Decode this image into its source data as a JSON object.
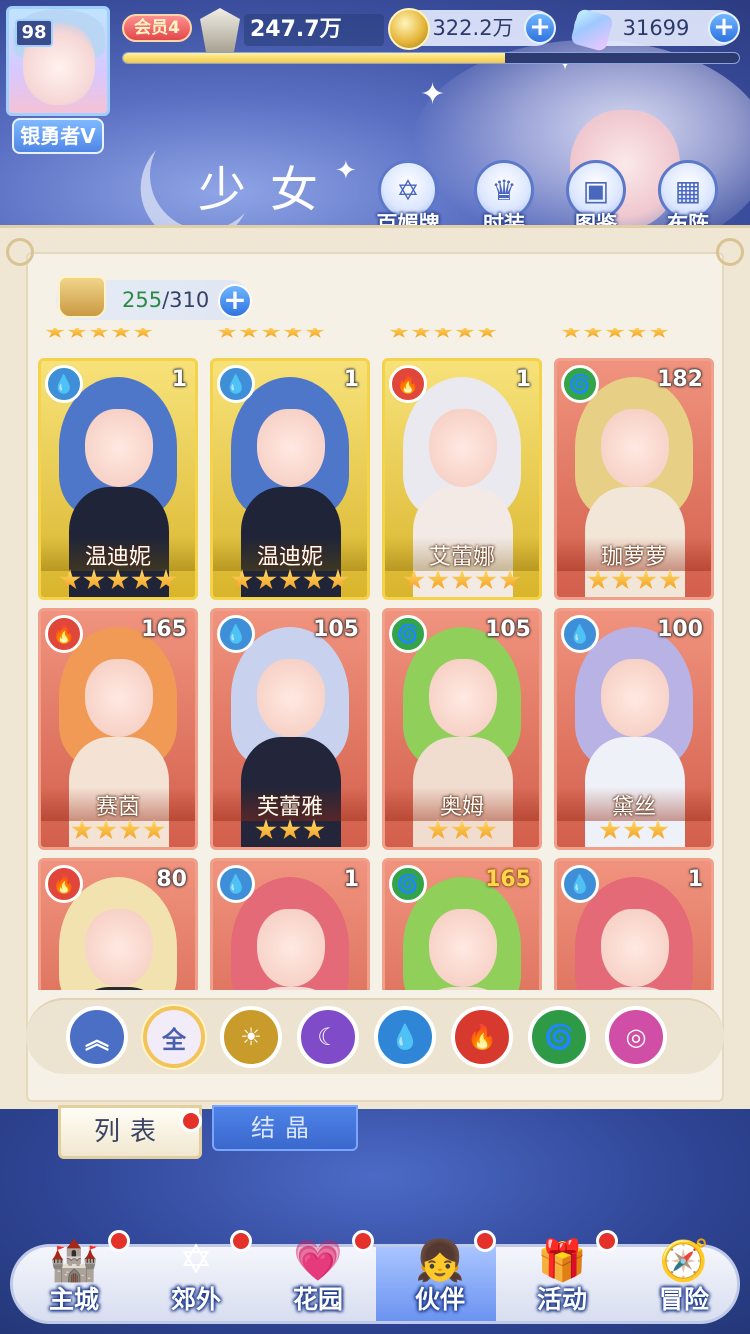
{
  "header": {
    "player_level": "98",
    "player_rank": "银勇者V",
    "vip_label": "会员4",
    "power": "247.7万",
    "exp_progress": 0.62,
    "gold": "322.2万",
    "gems": "31699",
    "plus_label": "+"
  },
  "page": {
    "title": "少女",
    "top_menu": [
      {
        "label": "百媚牌",
        "icon": "card-deck-icon"
      },
      {
        "label": "时装",
        "icon": "outfit-icon"
      },
      {
        "label": "图鉴",
        "icon": "codex-icon"
      },
      {
        "label": "布阵",
        "icon": "formation-icon"
      }
    ]
  },
  "capacity": {
    "current": "255",
    "max": "/310"
  },
  "cards": [
    {
      "name": "温迪妮",
      "level": "1",
      "element": "water",
      "stars": 5,
      "frame": "gold"
    },
    {
      "name": "温迪妮",
      "level": "1",
      "element": "water",
      "stars": 5,
      "frame": "gold"
    },
    {
      "name": "艾蕾娜",
      "level": "1",
      "element": "fire",
      "stars": 5,
      "frame": "gold"
    },
    {
      "name": "珈萝萝",
      "level": "182",
      "element": "wind",
      "stars": 4,
      "frame": "red"
    },
    {
      "name": "赛茵",
      "level": "165",
      "element": "fire",
      "stars": 4,
      "frame": "red"
    },
    {
      "name": "芙蕾雅",
      "level": "105",
      "element": "water",
      "stars": 3,
      "frame": "red"
    },
    {
      "name": "奥姆",
      "level": "105",
      "element": "wind",
      "stars": 3,
      "frame": "red"
    },
    {
      "name": "黛丝",
      "level": "100",
      "element": "water",
      "stars": 3,
      "frame": "red"
    },
    {
      "name": "",
      "level": "80",
      "element": "fire",
      "stars": 0,
      "frame": "red"
    },
    {
      "name": "",
      "level": "1",
      "element": "water",
      "stars": 0,
      "frame": "red"
    },
    {
      "name": "",
      "level": "165",
      "element": "wind",
      "stars": 0,
      "frame": "red"
    },
    {
      "name": "",
      "level": "1",
      "element": "water",
      "stars": 0,
      "frame": "red"
    }
  ],
  "filters": [
    {
      "name": "filter-favorite",
      "label": "",
      "icon": "wing-icon",
      "color": "#4a6fc4"
    },
    {
      "name": "filter-all",
      "label": "全",
      "icon": "",
      "color": "#f2ecf8"
    },
    {
      "name": "filter-light",
      "label": "",
      "icon": "sun-icon",
      "color": "#c89b2a"
    },
    {
      "name": "filter-dark",
      "label": "",
      "icon": "moon-icon",
      "color": "#7f4bc9"
    },
    {
      "name": "filter-water",
      "label": "",
      "icon": "water-drop-icon",
      "color": "#2f86d6"
    },
    {
      "name": "filter-fire",
      "label": "",
      "icon": "flame-icon",
      "color": "#d8392f"
    },
    {
      "name": "filter-wind",
      "label": "",
      "icon": "tornado-icon",
      "color": "#2f9a45"
    },
    {
      "name": "filter-magic",
      "label": "",
      "icon": "orbit-icon",
      "color": "#d04ea6"
    }
  ],
  "tabs": {
    "list": "列表",
    "crystal": "结晶"
  },
  "nav": [
    {
      "label": "主城",
      "icon": "castle-icon"
    },
    {
      "label": "郊外",
      "icon": "hexagram-icon"
    },
    {
      "label": "花园",
      "icon": "heart-icon"
    },
    {
      "label": "伙伴",
      "icon": "companion-icon"
    },
    {
      "label": "活动",
      "icon": "gift-icon"
    },
    {
      "label": "冒险",
      "icon": "compass-icon"
    }
  ]
}
